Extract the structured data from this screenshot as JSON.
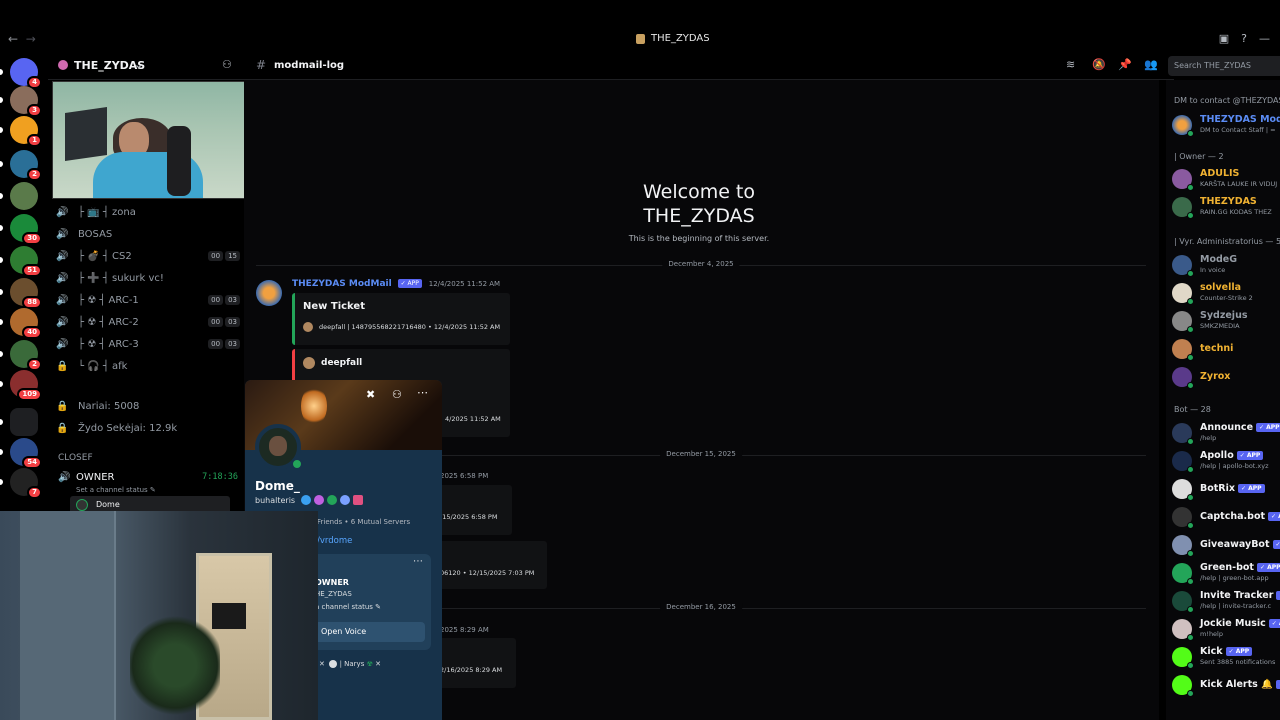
{
  "titlebar": {
    "title": "THE_ZYDAS",
    "back": "←",
    "forward": "→"
  },
  "server": {
    "name": "THE_ZYDAS",
    "chevron": "⌄"
  },
  "rail": [
    {
      "name": "discord-home",
      "badge": "4",
      "color": "#5865f2"
    },
    {
      "name": "server-1",
      "badge": "3",
      "color": "#8a6d5c"
    },
    {
      "name": "server-2",
      "badge": "1",
      "color": "#f0a020"
    },
    {
      "name": "server-3",
      "badge": "2",
      "color": "#2a6f97"
    },
    {
      "name": "server-4",
      "badge": "",
      "color": "#5a7a4a"
    },
    {
      "name": "server-5",
      "badge": "30",
      "color": "#1a8a3a"
    },
    {
      "name": "server-6",
      "badge": "51",
      "color": "#2e7d32"
    },
    {
      "name": "server-7",
      "badge": "88",
      "color": "#6b4e2e"
    },
    {
      "name": "server-8",
      "badge": "40",
      "color": "#b06a2e"
    },
    {
      "name": "server-9",
      "badge": "2",
      "color": "#3a6a3a"
    },
    {
      "name": "server-10",
      "badge": "109",
      "color": "#8a2e2e"
    },
    {
      "name": "folder",
      "badge": "",
      "color": "#5865f2"
    },
    {
      "name": "server-11",
      "badge": "54",
      "color": "#2a4a8a"
    },
    {
      "name": "server-12",
      "badge": "7",
      "color": "#222"
    }
  ],
  "channels": [
    {
      "label": "├ 📺 ┤ zona",
      "icon": "speaker-icon",
      "c1": "",
      "c2": ""
    },
    {
      "label": "BOSAS",
      "icon": "speaker-icon",
      "c1": "",
      "c2": ""
    },
    {
      "label": "├ 💣 ┤ CS2",
      "icon": "speaker-icon",
      "c1": "00",
      "c2": "15"
    },
    {
      "label": "├ ➕ ┤ sukurk vc!",
      "icon": "speaker-icon",
      "c1": "",
      "c2": ""
    },
    {
      "label": "├ ☢ ┤ ARC-1",
      "icon": "speaker-icon",
      "c1": "00",
      "c2": "03"
    },
    {
      "label": "├ ☢ ┤ ARC-2",
      "icon": "speaker-icon",
      "c1": "00",
      "c2": "03"
    },
    {
      "label": "├ ☢ ┤ ARC-3",
      "icon": "speaker-icon",
      "c1": "00",
      "c2": "03"
    },
    {
      "label": "└ 🎧 ┤ afk",
      "icon": "lock-icon",
      "c1": "",
      "c2": ""
    }
  ],
  "stats": [
    {
      "label": "Nariai: 5008"
    },
    {
      "label": "Žydo Sekėjai: 12.9k"
    }
  ],
  "category": "CLOSEF",
  "owner_channel": {
    "name": "OWNER",
    "timer": "7:18:36",
    "status": "Set a channel status ✎",
    "user": "Dome"
  },
  "channel": {
    "name": "modmail-log",
    "search_placeholder": "Search THE_ZYDAS"
  },
  "welcome": {
    "line1": "Welcome to",
    "line2": "THE_ZYDAS",
    "sub": "This is the beginning of this server."
  },
  "dates": [
    "December 4, 2025",
    "December 15, 2025",
    "December 16, 2025"
  ],
  "message": {
    "author": "THEZYDAS ModMail",
    "app": "✓ APP",
    "time": "12/4/2025 11:52 AM",
    "embed1_title": "New Ticket",
    "embed1_footer": "deepfall | 148795568221716480 • 12/4/2025 11:52 AM",
    "embed2_title": "deepfall",
    "embed2_footer": "4/2025 11:52 AM"
  },
  "fragments": [
    "2025 6:58 PM",
    "/15/2025 6:58 PM",
    "06120 • 12/15/2025 7:03 PM",
    "2025 8:29 AM",
    "2/16/2025 8:29 AM"
  ],
  "popout": {
    "name": "Dome_",
    "username": "buhalteris",
    "meta": "Friends • 6 Mutual Servers",
    "link": "/vrdome",
    "card_title": "OWNER",
    "card_server": "HE_ZYDAS",
    "card_status": "a channel status ✎",
    "button": "Open Voice",
    "tag": "| Narys"
  },
  "members": {
    "dm_header": "DM to contact @THEZYDAS",
    "modmail": {
      "name": "THEZYDAS ModM",
      "sub": "DM to Contact Staff | ="
    },
    "owner_group": "| Owner — 2",
    "owners": [
      {
        "name": "ADULIS",
        "sub": "KARŠTA LAUKE IR VIDUJ",
        "color": "#f0b232"
      },
      {
        "name": "THEZYDAS",
        "sub": "RAIN.GG KODAS THEZ",
        "color": "#f0b232"
      }
    ],
    "admin_group": "| Vyr. Administratorius — 5",
    "admins": [
      {
        "name": "ModeG",
        "sub": "In voice",
        "color": "#949ba4"
      },
      {
        "name": "solvella",
        "sub": "Counter-Strike 2",
        "color": "#f0b232"
      },
      {
        "name": "Sydzejus",
        "sub": "SMKZMEDIA",
        "color": "#949ba4"
      },
      {
        "name": "techni",
        "sub": "",
        "color": "#f0b232"
      },
      {
        "name": "Zyrox",
        "sub": "",
        "color": "#f0b232"
      }
    ],
    "bot_group": "Bot — 28",
    "bots": [
      {
        "name": "Announce",
        "sub": "/help"
      },
      {
        "name": "Apollo",
        "sub": "/help | apollo-bot.xyz"
      },
      {
        "name": "BotRix",
        "sub": ""
      },
      {
        "name": "Captcha.bot",
        "sub": ""
      },
      {
        "name": "GiveawayBot",
        "sub": ""
      },
      {
        "name": "Green-bot",
        "sub": "/help | green-bot.app"
      },
      {
        "name": "Invite Tracker",
        "sub": "/help | invite-tracker.c"
      },
      {
        "name": "Jockie Music",
        "sub": "m!help"
      },
      {
        "name": "Kick",
        "sub": "Sent 3885 notifications"
      },
      {
        "name": "Kick Alerts 🔔",
        "sub": ""
      }
    ]
  }
}
